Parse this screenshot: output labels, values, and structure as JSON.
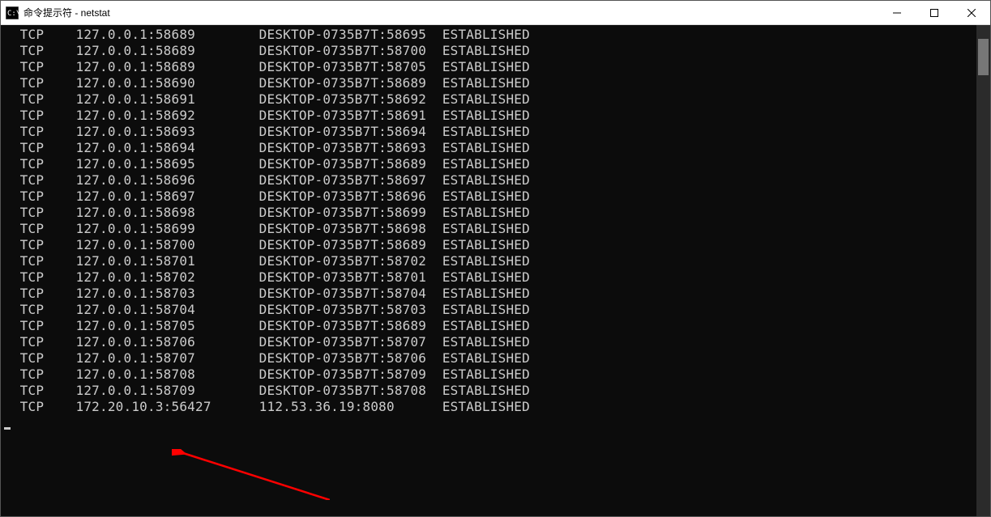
{
  "window": {
    "title": "命令提示符 - netstat"
  },
  "rows": [
    {
      "proto": "TCP",
      "local": "127.0.0.1:58689",
      "remote": "DESKTOP-0735B7T:58695",
      "state": "ESTABLISHED"
    },
    {
      "proto": "TCP",
      "local": "127.0.0.1:58689",
      "remote": "DESKTOP-0735B7T:58700",
      "state": "ESTABLISHED"
    },
    {
      "proto": "TCP",
      "local": "127.0.0.1:58689",
      "remote": "DESKTOP-0735B7T:58705",
      "state": "ESTABLISHED"
    },
    {
      "proto": "TCP",
      "local": "127.0.0.1:58690",
      "remote": "DESKTOP-0735B7T:58689",
      "state": "ESTABLISHED"
    },
    {
      "proto": "TCP",
      "local": "127.0.0.1:58691",
      "remote": "DESKTOP-0735B7T:58692",
      "state": "ESTABLISHED"
    },
    {
      "proto": "TCP",
      "local": "127.0.0.1:58692",
      "remote": "DESKTOP-0735B7T:58691",
      "state": "ESTABLISHED"
    },
    {
      "proto": "TCP",
      "local": "127.0.0.1:58693",
      "remote": "DESKTOP-0735B7T:58694",
      "state": "ESTABLISHED"
    },
    {
      "proto": "TCP",
      "local": "127.0.0.1:58694",
      "remote": "DESKTOP-0735B7T:58693",
      "state": "ESTABLISHED"
    },
    {
      "proto": "TCP",
      "local": "127.0.0.1:58695",
      "remote": "DESKTOP-0735B7T:58689",
      "state": "ESTABLISHED"
    },
    {
      "proto": "TCP",
      "local": "127.0.0.1:58696",
      "remote": "DESKTOP-0735B7T:58697",
      "state": "ESTABLISHED"
    },
    {
      "proto": "TCP",
      "local": "127.0.0.1:58697",
      "remote": "DESKTOP-0735B7T:58696",
      "state": "ESTABLISHED"
    },
    {
      "proto": "TCP",
      "local": "127.0.0.1:58698",
      "remote": "DESKTOP-0735B7T:58699",
      "state": "ESTABLISHED"
    },
    {
      "proto": "TCP",
      "local": "127.0.0.1:58699",
      "remote": "DESKTOP-0735B7T:58698",
      "state": "ESTABLISHED"
    },
    {
      "proto": "TCP",
      "local": "127.0.0.1:58700",
      "remote": "DESKTOP-0735B7T:58689",
      "state": "ESTABLISHED"
    },
    {
      "proto": "TCP",
      "local": "127.0.0.1:58701",
      "remote": "DESKTOP-0735B7T:58702",
      "state": "ESTABLISHED"
    },
    {
      "proto": "TCP",
      "local": "127.0.0.1:58702",
      "remote": "DESKTOP-0735B7T:58701",
      "state": "ESTABLISHED"
    },
    {
      "proto": "TCP",
      "local": "127.0.0.1:58703",
      "remote": "DESKTOP-0735B7T:58704",
      "state": "ESTABLISHED"
    },
    {
      "proto": "TCP",
      "local": "127.0.0.1:58704",
      "remote": "DESKTOP-0735B7T:58703",
      "state": "ESTABLISHED"
    },
    {
      "proto": "TCP",
      "local": "127.0.0.1:58705",
      "remote": "DESKTOP-0735B7T:58689",
      "state": "ESTABLISHED"
    },
    {
      "proto": "TCP",
      "local": "127.0.0.1:58706",
      "remote": "DESKTOP-0735B7T:58707",
      "state": "ESTABLISHED"
    },
    {
      "proto": "TCP",
      "local": "127.0.0.1:58707",
      "remote": "DESKTOP-0735B7T:58706",
      "state": "ESTABLISHED"
    },
    {
      "proto": "TCP",
      "local": "127.0.0.1:58708",
      "remote": "DESKTOP-0735B7T:58709",
      "state": "ESTABLISHED"
    },
    {
      "proto": "TCP",
      "local": "127.0.0.1:58709",
      "remote": "DESKTOP-0735B7T:58708",
      "state": "ESTABLISHED"
    },
    {
      "proto": "TCP",
      "local": "172.20.10.3:56427",
      "remote": "112.53.36.19:8080",
      "state": "ESTABLISHED"
    }
  ]
}
